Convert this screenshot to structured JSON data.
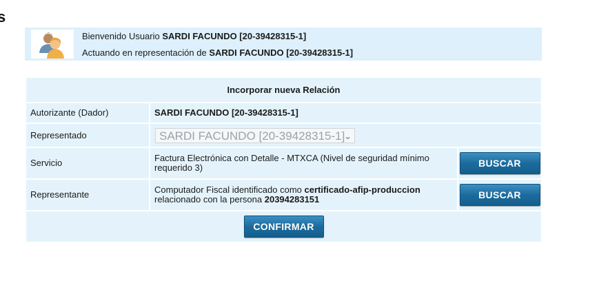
{
  "page": {
    "corner_glyph": "s"
  },
  "welcome": {
    "line1_prefix": "Bienvenido Usuario ",
    "user": "SARDI FACUNDO [20-39428315-1]",
    "line2_prefix": "Actuando en representación de ",
    "represented": "SARDI FACUNDO [20-39428315-1]",
    "avatar_icon": "users-icon"
  },
  "form": {
    "title": "Incorporar nueva Relación",
    "autorizante": {
      "label": "Autorizante (Dador)",
      "value": "SARDI FACUNDO [20-39428315-1]"
    },
    "representado": {
      "label": "Representado",
      "selected": "SARDI FACUNDO [20-39428315-1]"
    },
    "servicio": {
      "label": "Servicio",
      "value": "Factura Electrónica con Detalle - MTXCA (Nivel de seguridad mínimo requerido 3)",
      "button": "BUSCAR"
    },
    "representante": {
      "label": "Representante",
      "text_prefix": "Computador Fiscal identificado como ",
      "certificate": "certificado-afip-produccion",
      "text_middle": " relacionado con la persona ",
      "person": "20394283151",
      "button": "BUSCAR"
    },
    "confirm_button": "CONFIRMAR"
  },
  "colors": {
    "panel_bg": "#e4f3fb",
    "button_blue": "#1d6b9d",
    "button_text": "#ffffff"
  }
}
